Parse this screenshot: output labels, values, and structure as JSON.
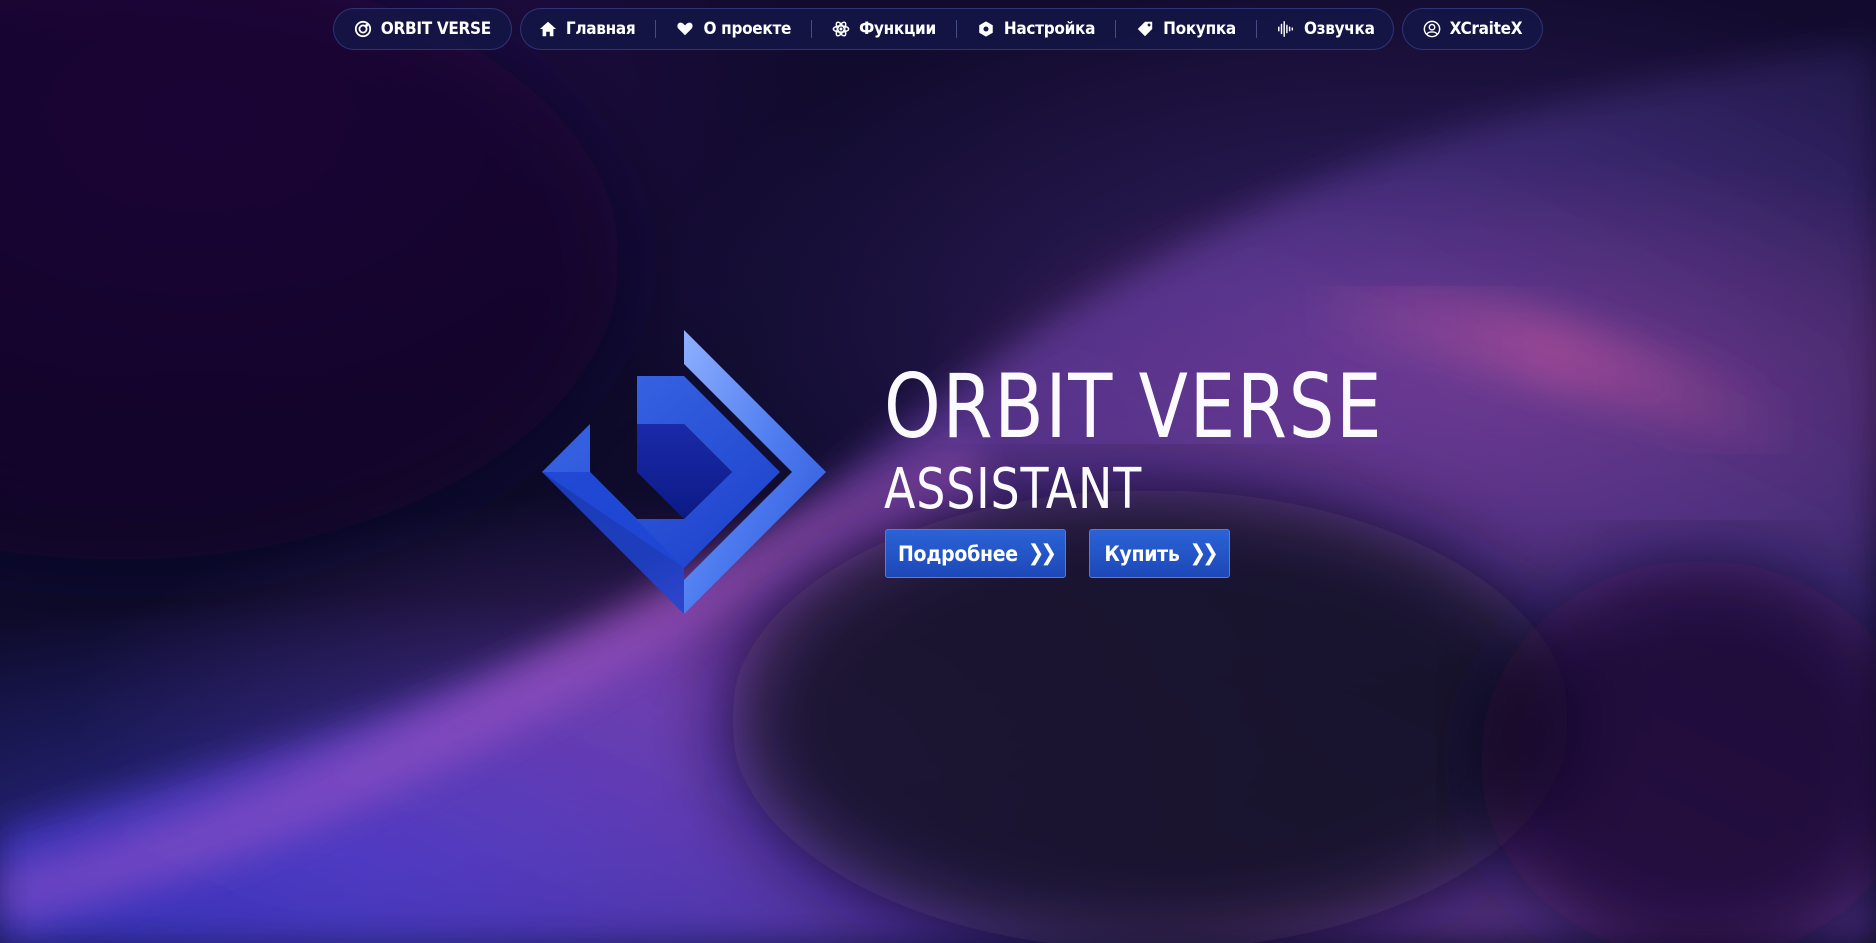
{
  "brand": {
    "label": "ORBIT VERSE",
    "icon": "orbit-icon"
  },
  "nav": {
    "items": [
      {
        "label": "Главная",
        "icon": "home-icon"
      },
      {
        "label": "О проекте",
        "icon": "heart-icon"
      },
      {
        "label": "Функции",
        "icon": "atom-icon"
      },
      {
        "label": "Настройка",
        "icon": "hexagon-icon"
      },
      {
        "label": "Покупка",
        "icon": "tag-icon"
      },
      {
        "label": "Озвучка",
        "icon": "waveform-icon"
      }
    ]
  },
  "user": {
    "label": "XCraiteX",
    "icon": "user-circle-icon"
  },
  "hero": {
    "title": "ORBIT VERSE",
    "subtitle": "ASSISTANT",
    "more_button": "Подробнее",
    "buy_button": "Купить"
  },
  "colors": {
    "accent": "#2b63d6",
    "background": "#0d0a2a",
    "nav_pill": "#14164a"
  }
}
